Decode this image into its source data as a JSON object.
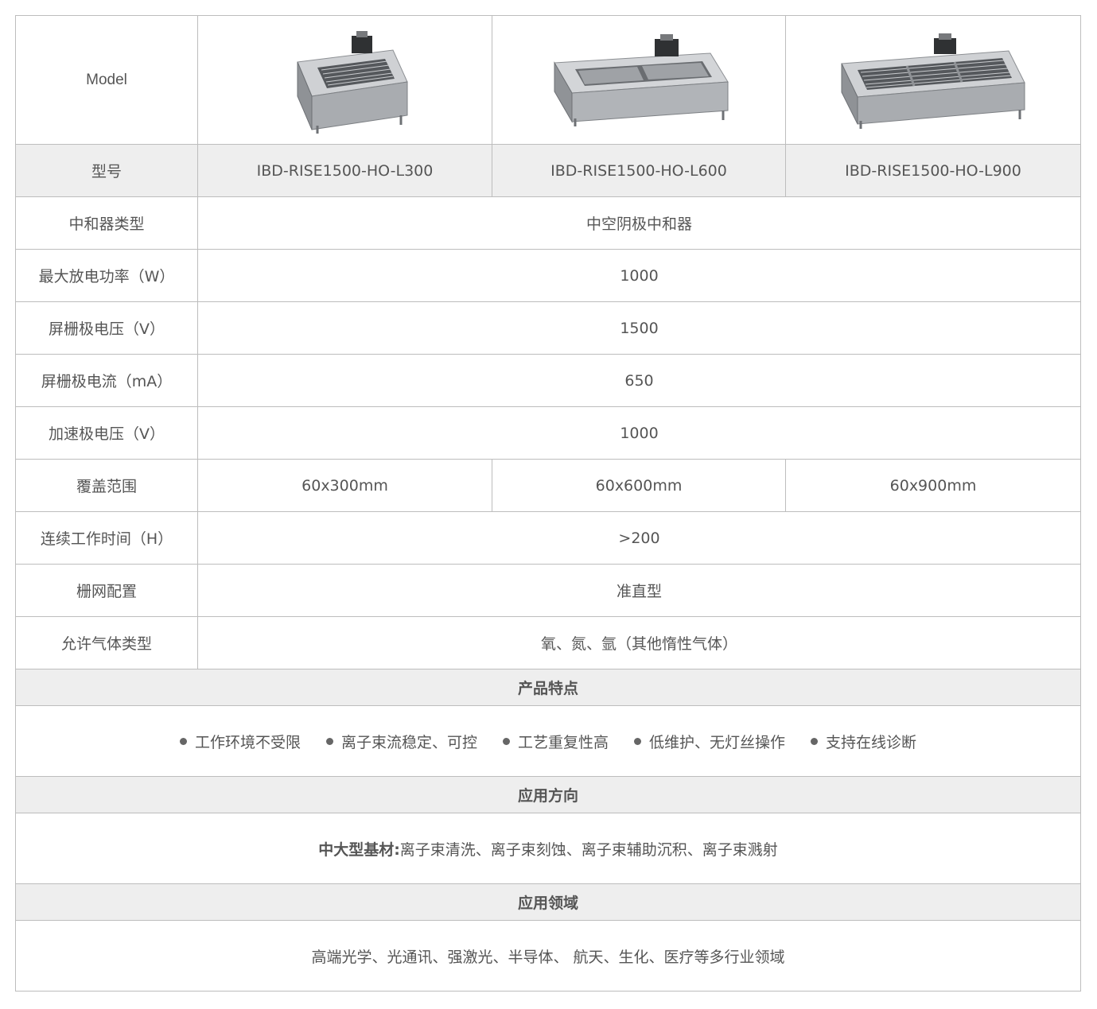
{
  "header": {
    "label": "Model",
    "products": [
      {
        "image": "ion-source-l300-photo"
      },
      {
        "image": "ion-source-l600-photo"
      },
      {
        "image": "ion-source-l900-photo"
      }
    ]
  },
  "rows": {
    "model": {
      "label": "型号",
      "values": [
        "IBD-RISE1500-HO-L300",
        "IBD-RISE1500-HO-L600",
        "IBD-RISE1500-HO-L900"
      ]
    },
    "neutralizer": {
      "label": "中和器类型",
      "value": "中空阴极中和器"
    },
    "discharge_power": {
      "label": "最大放电功率（W）",
      "value": "1000"
    },
    "screen_voltage": {
      "label": "屏栅极电压（V）",
      "value": "1500"
    },
    "screen_current": {
      "label": "屏栅极电流（mA）",
      "value": "650"
    },
    "accel_voltage": {
      "label": "加速极电压（V）",
      "value": "1000"
    },
    "coverage": {
      "label": "覆盖范围",
      "values": [
        "60x300mm",
        "60x600mm",
        "60x900mm"
      ]
    },
    "continuous_time": {
      "label": "连续工作时间（H）",
      "value": ">200"
    },
    "grid_config": {
      "label": "栅网配置",
      "value": "准直型"
    },
    "gas_types": {
      "label": "允许气体类型",
      "value": "氧、氮、氩（其他惰性气体）"
    }
  },
  "features": {
    "title": "产品特点",
    "items": [
      "工作环境不受限",
      "离子束流稳定、可控",
      "工艺重复性高",
      "低维护、无灯丝操作",
      "支持在线诊断"
    ]
  },
  "applications": {
    "title": "应用方向",
    "prefix": "中大型基材:",
    "text": "离子束清洗、离子束刻蚀、离子束辅助沉积、离子束溅射"
  },
  "fields": {
    "title": "应用领域",
    "text": "高端光学、光通讯、强激光、半导体、 航天、生化、医疗等多行业领域"
  },
  "colors": {
    "border": "#bdbdbd",
    "shade": "#eeeeee",
    "text": "#555555"
  }
}
